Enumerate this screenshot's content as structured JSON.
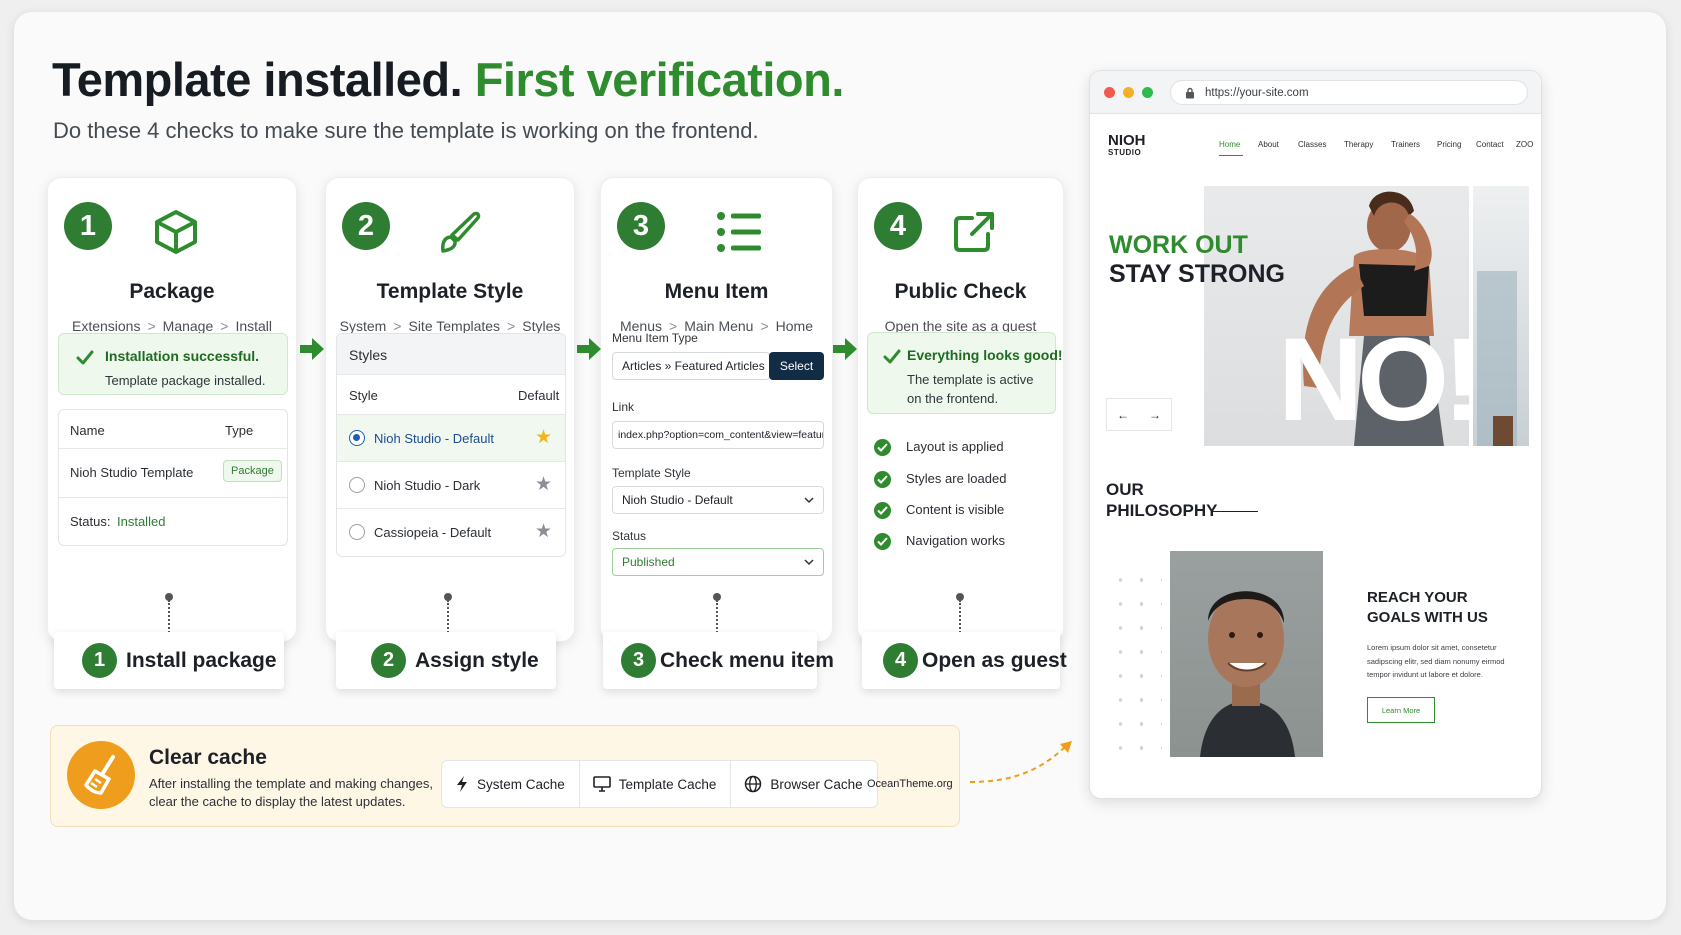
{
  "header": {
    "title_main": "Template installed.",
    "title_accent": "First verification.",
    "subtitle": "Do these 4 checks to make sure the template is working on the frontend."
  },
  "colors": {
    "accent_green": "#2e8b2e",
    "step_green": "#2e7d32",
    "cache_orange": "#ef9d1c",
    "select_navy": "#132c46",
    "star_yellow": "#f2b51e"
  },
  "steps": [
    {
      "number": "1",
      "icon": "package-box-icon",
      "title": "Package",
      "crumbs": [
        "Extensions",
        "Manage",
        "Install"
      ],
      "success_title": "Installation successful.",
      "success_text": "Template package installed.",
      "table_headers": [
        "Name",
        "Type"
      ],
      "row_name": "Nioh Studio Template",
      "row_type": "Package",
      "status_label": "Status:",
      "status_value": "Installed"
    },
    {
      "number": "2",
      "icon": "paintbrush-icon",
      "title": "Template Style",
      "crumbs": [
        "System",
        "Site Templates",
        "Styles"
      ],
      "panel_title": "Styles",
      "col_style": "Style",
      "col_default": "Default",
      "styles": [
        {
          "name": "Nioh Studio - Default",
          "selected": true,
          "default": true
        },
        {
          "name": "Nioh Studio - Dark",
          "selected": false,
          "default": false
        },
        {
          "name": "Cassiopeia - Default",
          "selected": false,
          "default": false
        }
      ]
    },
    {
      "number": "3",
      "icon": "list-icon",
      "title": "Menu Item",
      "crumbs": [
        "Menus",
        "Main Menu",
        "Home"
      ],
      "type_label": "Menu Item Type",
      "type_value": "Articles » Featured Articles",
      "select_label": "Select",
      "link_label": "Link",
      "link_value": "index.php?option=com_content&view=featured",
      "style_label": "Template Style",
      "style_value": "Nioh Studio - Default",
      "status_label": "Status",
      "status_value": "Published"
    },
    {
      "number": "4",
      "icon": "external-link-icon",
      "title": "Public Check",
      "subtitle": "Open the site as a guest",
      "success_title": "Everything looks good!",
      "success_text_1": "The template is active",
      "success_text_2": "on the frontend.",
      "checks": [
        "Layout is applied",
        "Styles are loaded",
        "Content is visible",
        "Navigation works"
      ]
    }
  ],
  "pills": [
    {
      "number": "1",
      "label": "Install package"
    },
    {
      "number": "2",
      "label": "Assign style"
    },
    {
      "number": "3",
      "label": "Check menu item"
    },
    {
      "number": "4",
      "label": "Open as guest"
    }
  ],
  "cache": {
    "icon": "broom-icon",
    "title": "Clear cache",
    "text": "After installing the template and making changes, clear the cache to display the latest updates.",
    "buttons": [
      {
        "icon": "bolt-icon",
        "label": "System Cache"
      },
      {
        "icon": "monitor-icon",
        "label": "Template Cache"
      },
      {
        "icon": "globe-icon",
        "label": "Browser Cache"
      }
    ],
    "credit": "OceanTheme.org"
  },
  "browser": {
    "url": "https://your-site.com",
    "brand_1": "NIOH",
    "brand_2": "STUDIO",
    "nav": [
      "Home",
      "About",
      "Classes",
      "Therapy",
      "Trainers",
      "Pricing",
      "Contact",
      "ZOO"
    ],
    "hero_line_1": "WORK OUT",
    "hero_line_2": "STAY STRONG",
    "hero_big": "NO!",
    "prev": "←",
    "next": "→",
    "philosophy_1": "OUR",
    "philosophy_2": "PHILOSOPHY",
    "reach_1": "REACH YOUR",
    "reach_2": "GOALS WITH US",
    "lorem": "Lorem ipsum dolor sit amet, consetetur sadipscing elitr, sed diam nonumy eirmod tempor invidunt ut labore et dolore.",
    "learn_more": "Learn More"
  }
}
